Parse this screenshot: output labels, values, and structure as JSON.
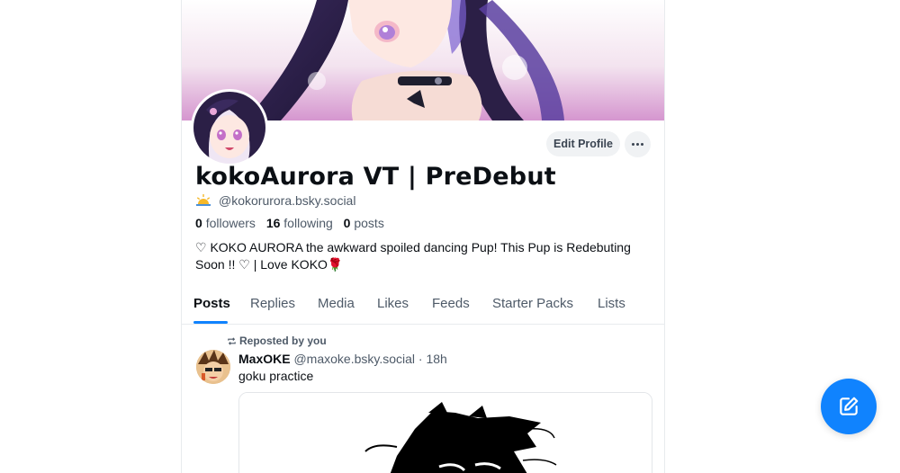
{
  "profile": {
    "display_name": "kokoAurora VT | PreDebut",
    "handle": "@kokorurora.bsky.social",
    "followers_count": "0",
    "followers_label": "followers",
    "following_count": "16",
    "following_label": "following",
    "posts_count": "0",
    "posts_label": "posts",
    "bio_line1": "♡ KOKO AURORA the awkward spoiled dancing Pup! This Pup is Redebuting",
    "bio_line2": "Soon !! ♡ | Love KOKO🌹"
  },
  "actions": {
    "edit_profile": "Edit Profile"
  },
  "tabs": [
    {
      "label": "Posts"
    },
    {
      "label": "Replies"
    },
    {
      "label": "Media"
    },
    {
      "label": "Likes"
    },
    {
      "label": "Feeds"
    },
    {
      "label": "Starter Packs"
    },
    {
      "label": "Lists"
    }
  ],
  "feed": {
    "items": [
      {
        "reason": "Reposted by you",
        "author": "MaxOKE",
        "handle": "@maxoke.bsky.social",
        "age": "· 18h",
        "text": "goku practice"
      }
    ]
  },
  "colors": {
    "accent": "#1083fe",
    "text_primary": "#0b0f14",
    "text_secondary": "#4e5a68",
    "button_bg": "#f0f2f4",
    "border": "#e8ebee"
  },
  "icons": {
    "more": "ellipsis-icon",
    "repost": "repost-icon",
    "compose": "compose-icon",
    "handle_badge": "sunrise-icon"
  }
}
